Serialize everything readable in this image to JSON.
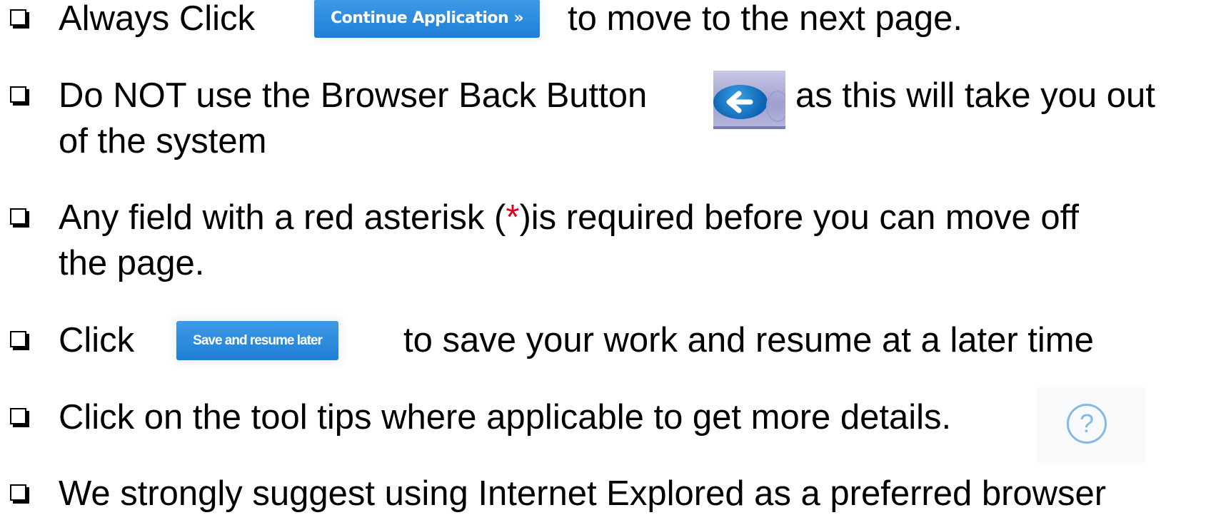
{
  "bullets": {
    "continue": {
      "before": "Always Click",
      "button_label": "Continue Application »",
      "after": "to move to the next page."
    },
    "back": {
      "before": "Do NOT use the Browser Back Button",
      "after": "as this will take you out",
      "line2": "of the system",
      "icon": "browser-back-arrow-icon"
    },
    "required": {
      "before": "Any field with a red asterisk (",
      "asterisk": "*",
      "after": ")is required before you can move off",
      "line2": "the page."
    },
    "save": {
      "before": "Click",
      "button_label": "Save and resume later",
      "after": "to save your work and resume at a later time"
    },
    "tooltips": {
      "text": "Click on the tool tips where applicable to get more details.",
      "icon_glyph": "?",
      "icon": "question-mark-help-icon"
    },
    "browser": {
      "text": "We strongly suggest using Internet Explored as a preferred browser"
    }
  },
  "colors": {
    "button_blue": "#2787dc",
    "asterisk_red": "#e0001b",
    "help_icon_blue": "#86b9e2",
    "text": "#000000",
    "background": "#ffffff"
  }
}
